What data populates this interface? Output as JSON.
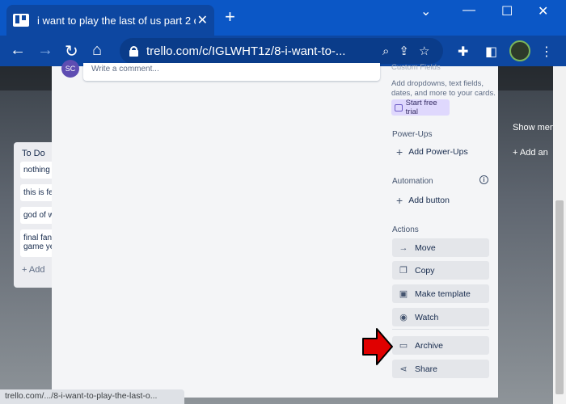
{
  "browser": {
    "tab_title": "i want to play the last of us part 2 o",
    "new_tab": "+",
    "url": "trello.com/c/IGLWHT1z/8-i-want-to-...",
    "status_url": "trello.com/.../8-i-want-to-play-the-last-o..."
  },
  "board": {
    "list_title": "To Do",
    "cards": [
      "nothing",
      "this is fe",
      "god of w",
      "final fan game ye"
    ],
    "add_card": "+ Add",
    "show_menu": "Show menu",
    "add_another": "+ Add an"
  },
  "comment": {
    "avatar_initials": "SC",
    "placeholder": "Write a comment..."
  },
  "sidebar": {
    "custom_fields_label": "Custom Fields",
    "custom_fields_desc": [
      "Add dropdowns, text fields,",
      "dates, and more to your cards."
    ],
    "start_trial": "Start free trial",
    "powerups_title": "Power-Ups",
    "add_powerups": "Add Power-Ups",
    "automation_title": "Automation",
    "add_button": "Add button",
    "actions_title": "Actions",
    "actions": [
      "Move",
      "Copy",
      "Make template",
      "Watch",
      "Archive",
      "Share"
    ]
  },
  "colors": {
    "chrome_blue": "#0d47a1",
    "trial_purple": "#dfd8fd",
    "arrow_red": "#e00000"
  }
}
